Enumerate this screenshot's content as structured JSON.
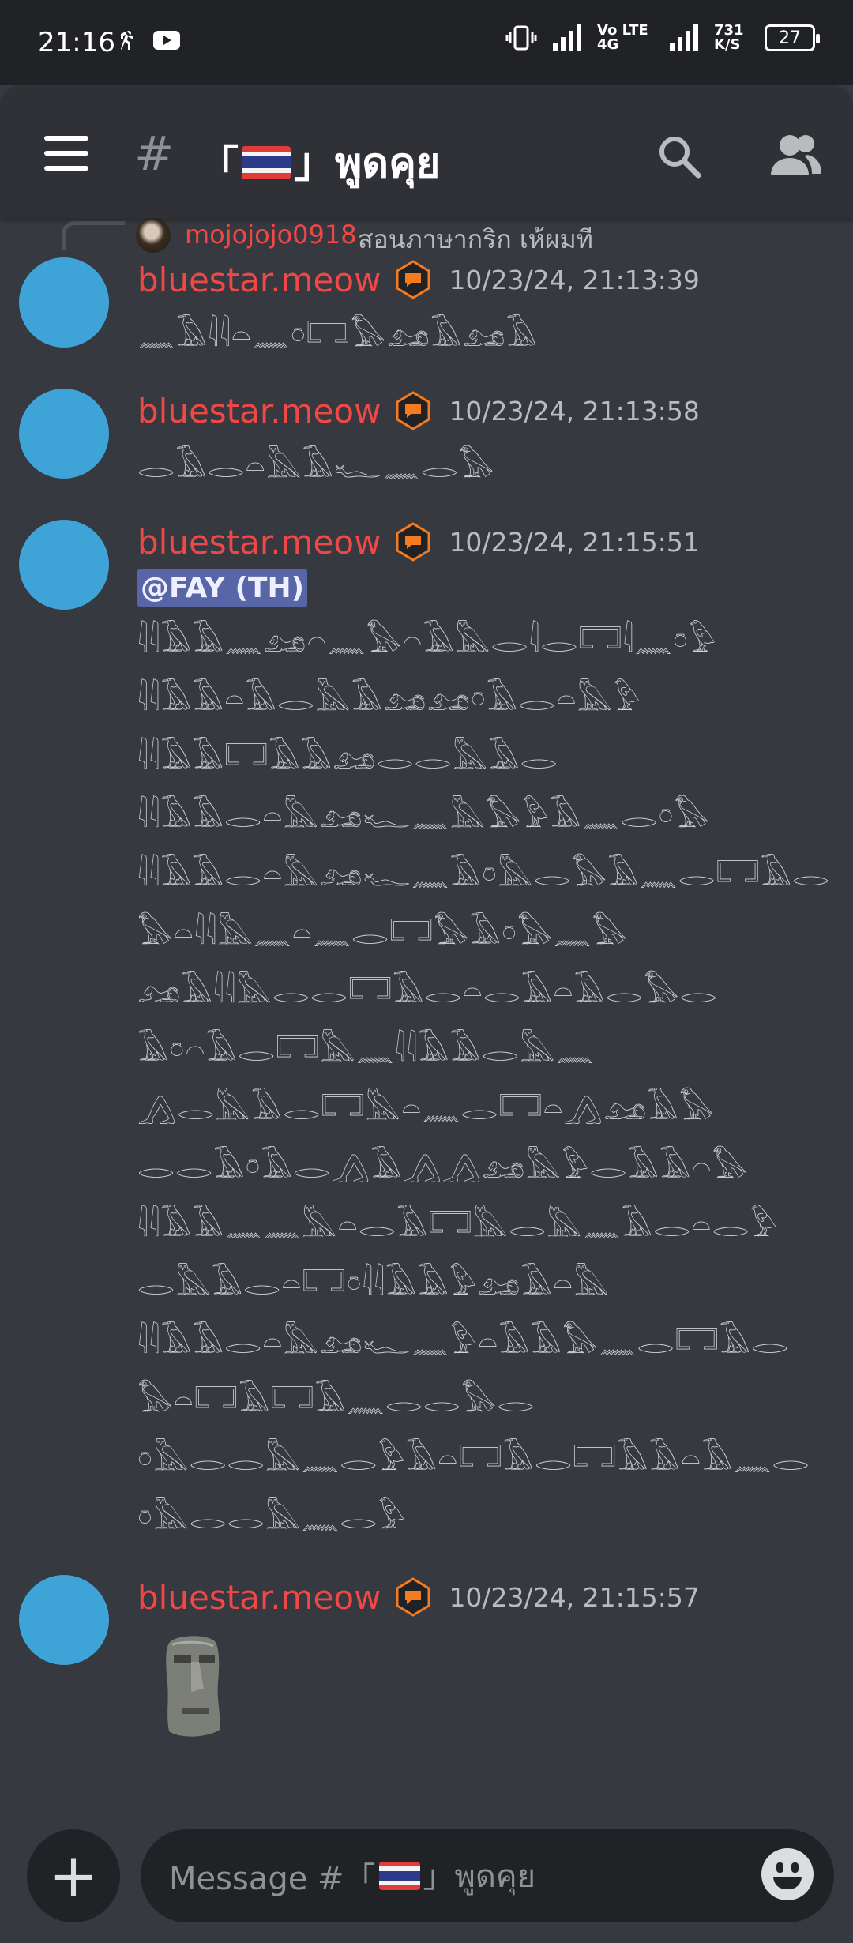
{
  "status_bar": {
    "time": "21:16",
    "network": "Vo LTE 4G",
    "speed": "731 K/S",
    "battery": "27"
  },
  "channel": {
    "hash": "#",
    "name": "「🇹🇭」พูดคุย",
    "name_left": "「",
    "name_right": "」พูดคุย"
  },
  "reply": {
    "author": "mojojojo0918",
    "text": "สอนภาษากริก เห้ผมที"
  },
  "messages": [
    {
      "author": "bluestar.meow",
      "timestamp": "10/23/24, 21:13:39",
      "lines": [
        "𓈖𓄿𓇋𓇋𓏏𓈖𓏌𓉐𓅃𓃭𓄿𓃭𓄿"
      ]
    },
    {
      "author": "bluestar.meow",
      "timestamp": "10/23/24, 21:13:58",
      "lines": [
        "𓂋𓄿𓂋𓏏𓅓𓄿𓆑𓈖𓂋𓅃"
      ]
    },
    {
      "author": "bluestar.meow",
      "timestamp": "10/23/24, 21:15:51",
      "mention": "@FAY (TH)",
      "lines": [
        "𓇋𓇋𓄿𓄿𓈖𓃭𓏏𓈖𓅃𓏏𓄿𓅓𓂋𓇋𓂋𓉐𓇋𓈖𓏌𓅱",
        "𓇋𓇋𓄿𓄿𓏏𓄿𓂋𓅓𓄿𓃭𓃭𓏌𓄿𓂋𓏏𓅓𓅱",
        "𓇋𓇋𓄿𓄿𓉐𓄿𓄿𓃭𓂋𓂋𓅓𓄿𓂋",
        "𓇋𓇋𓄿𓄿𓂋𓏏𓅓𓃭𓆑𓈖𓅓𓅃𓅱𓄿𓈖𓂋𓏌𓅃",
        "𓇋𓇋𓄿𓄿𓂋𓏏𓅓𓃭𓆑𓈖𓄿𓏌𓅓𓂋𓅃𓄿𓈖𓂋𓉐𓄿𓂋",
        "𓅃𓏏𓇋𓇋𓅓𓈖𓏏𓈖𓂋𓉐𓅃𓄿𓏌𓅃𓈖𓅃",
        "𓃭𓄿𓇋𓇋𓅓𓂋𓂋𓉐𓄿𓂋𓏏𓂋𓄿𓏏𓄿𓂋𓅃𓂋",
        "𓄿𓏌𓏏𓄿𓂋𓉐𓅓𓈖𓇋𓇋𓄿𓄿𓂋𓅓𓈖",
        "𓂻𓂋𓅓𓄿𓂋𓉐𓅓𓏏𓈖𓂋𓉐𓏏𓂻𓃭𓄿𓅃",
        "𓂋𓂋𓄿𓏌𓄿𓂋𓂻𓄿𓂻𓂻𓃭𓅓𓅱𓂋𓄿𓄿𓏏𓅃",
        "𓇋𓇋𓄿𓄿𓈖𓈖𓅓𓏏𓂋𓄿𓉐𓅓𓂋𓅓𓈖𓄿𓂋𓏏𓂋𓅱",
        "𓂋𓅓𓄿𓂋𓏏𓉐𓏌𓇋𓇋𓄿𓄿𓅱𓃭𓄿𓏏𓅓",
        "𓇋𓇋𓄿𓄿𓂋𓏏𓅓𓃭𓆑𓈖𓅱𓏏𓄿𓄿𓅃𓈖𓂋𓉐𓄿𓂋",
        "𓅃𓏏𓉐𓄿𓉐𓄿𓈖𓂋𓂋𓅃𓂋",
        "𓏌𓅓𓂋𓂋𓅓𓈖𓂋𓅱𓄿𓏏𓉐𓄿𓂋𓉐𓄿𓄿𓏏𓄿𓈖𓂋",
        "𓏌𓅓𓂋𓂋𓅓𓈖𓂋𓅱"
      ]
    },
    {
      "author": "bluestar.meow",
      "timestamp": "10/23/24, 21:15:57",
      "sticker": "moai"
    }
  ],
  "composer": {
    "add_icon": "+",
    "placeholder": "Message #「🇹🇭」พูดคุย",
    "placeholder_left": "Message #「",
    "placeholder_right": "」พูดคุย"
  },
  "colors": {
    "background": "#36393f",
    "header": "#2f3136",
    "author": "#f04747",
    "avatar": "#3ea3d6",
    "mention_bg": "#5865a6",
    "badge": "#f47b20"
  }
}
